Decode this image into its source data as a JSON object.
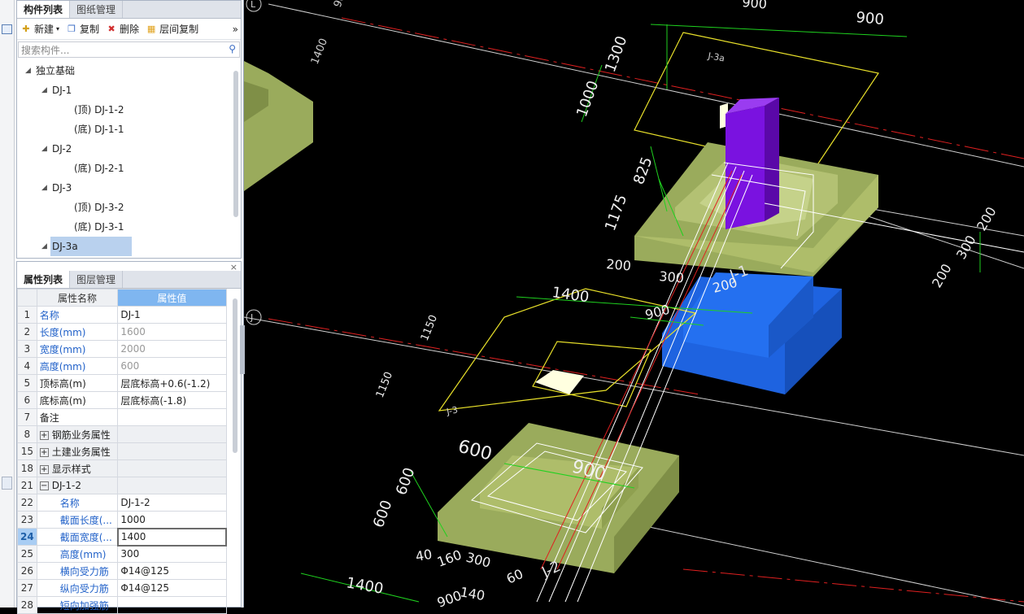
{
  "panel1": {
    "tabs": [
      "构件列表",
      "图纸管理"
    ],
    "toolbar": {
      "new": "新建",
      "copy": "复制",
      "delete": "删除",
      "layer_copy": "层间复制",
      "more": "»"
    },
    "search_placeholder": "搜索构件...",
    "tree": {
      "root": "独立基础",
      "nodes": [
        {
          "label": "DJ-1",
          "children": [
            "(顶) DJ-1-2",
            "(底) DJ-1-1"
          ]
        },
        {
          "label": "DJ-2",
          "children": [
            "(底) DJ-2-1"
          ]
        },
        {
          "label": "DJ-3",
          "children": [
            "(顶) DJ-3-2",
            "(底) DJ-3-1"
          ]
        },
        {
          "label": "DJ-3a",
          "children": []
        }
      ]
    }
  },
  "panel2": {
    "tabs": [
      "属性列表",
      "图层管理"
    ],
    "close": "×",
    "header": {
      "name": "属性名称",
      "value": "属性值"
    },
    "rows": [
      {
        "n": "1",
        "name": "名称",
        "value": "DJ-1"
      },
      {
        "n": "2",
        "name": "长度(mm)",
        "value": "1600"
      },
      {
        "n": "3",
        "name": "宽度(mm)",
        "value": "2000"
      },
      {
        "n": "4",
        "name": "高度(mm)",
        "value": "600"
      },
      {
        "n": "5",
        "name": "顶标高(m)",
        "value": "层底标高+0.6(-1.2)"
      },
      {
        "n": "6",
        "name": "底标高(m)",
        "value": "层底标高(-1.8)"
      },
      {
        "n": "7",
        "name": "备注",
        "value": ""
      },
      {
        "n": "8",
        "name": "钢筋业务属性",
        "value": ""
      },
      {
        "n": "15",
        "name": "土建业务属性",
        "value": ""
      },
      {
        "n": "18",
        "name": "显示样式",
        "value": ""
      },
      {
        "n": "21",
        "name": "DJ-1-2",
        "value": ""
      },
      {
        "n": "22",
        "name": "名称",
        "value": "DJ-1-2"
      },
      {
        "n": "23",
        "name": "截面长度(...",
        "value": "1000"
      },
      {
        "n": "24",
        "name": "截面宽度(...",
        "value": "1400"
      },
      {
        "n": "25",
        "name": "高度(mm)",
        "value": "300"
      },
      {
        "n": "26",
        "name": "横向受力筋",
        "value": "Φ14@125"
      },
      {
        "n": "27",
        "name": "纵向受力筋",
        "value": "Φ14@125"
      },
      {
        "n": "28",
        "name": "短向加强筋",
        "value": ""
      }
    ],
    "plus": "+",
    "minus": "−"
  },
  "cad": {
    "axis_labels": [
      "L",
      "J"
    ],
    "dims": [
      "900",
      "1300",
      "1000",
      "825",
      "1175",
      "200",
      "300",
      "200",
      "900",
      "200",
      "300",
      "200",
      "1400",
      "1150",
      "1150",
      "1400",
      "600",
      "600",
      "600",
      "900",
      "40",
      "160",
      "300",
      "60",
      "1400",
      "140",
      "900",
      "1400",
      "1400"
    ],
    "labels": [
      "J-3a",
      "J-1",
      "J-3",
      "J-2"
    ],
    "colors": {
      "olive": "#9aab5c",
      "blue": "#1e63e0",
      "purple": "#7a12e0",
      "yellow": "#e8e02a",
      "green": "#1fd11f"
    }
  }
}
